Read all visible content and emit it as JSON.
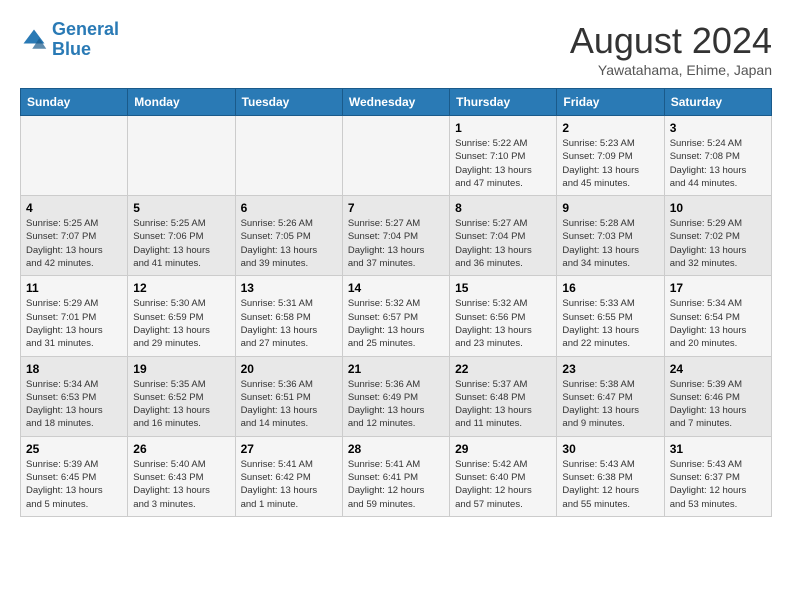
{
  "header": {
    "logo_line1": "General",
    "logo_line2": "Blue",
    "month_title": "August 2024",
    "subtitle": "Yawatahama, Ehime, Japan"
  },
  "weekdays": [
    "Sunday",
    "Monday",
    "Tuesday",
    "Wednesday",
    "Thursday",
    "Friday",
    "Saturday"
  ],
  "weeks": [
    [
      {
        "day": "",
        "info": ""
      },
      {
        "day": "",
        "info": ""
      },
      {
        "day": "",
        "info": ""
      },
      {
        "day": "",
        "info": ""
      },
      {
        "day": "1",
        "info": "Sunrise: 5:22 AM\nSunset: 7:10 PM\nDaylight: 13 hours\nand 47 minutes."
      },
      {
        "day": "2",
        "info": "Sunrise: 5:23 AM\nSunset: 7:09 PM\nDaylight: 13 hours\nand 45 minutes."
      },
      {
        "day": "3",
        "info": "Sunrise: 5:24 AM\nSunset: 7:08 PM\nDaylight: 13 hours\nand 44 minutes."
      }
    ],
    [
      {
        "day": "4",
        "info": "Sunrise: 5:25 AM\nSunset: 7:07 PM\nDaylight: 13 hours\nand 42 minutes."
      },
      {
        "day": "5",
        "info": "Sunrise: 5:25 AM\nSunset: 7:06 PM\nDaylight: 13 hours\nand 41 minutes."
      },
      {
        "day": "6",
        "info": "Sunrise: 5:26 AM\nSunset: 7:05 PM\nDaylight: 13 hours\nand 39 minutes."
      },
      {
        "day": "7",
        "info": "Sunrise: 5:27 AM\nSunset: 7:04 PM\nDaylight: 13 hours\nand 37 minutes."
      },
      {
        "day": "8",
        "info": "Sunrise: 5:27 AM\nSunset: 7:04 PM\nDaylight: 13 hours\nand 36 minutes."
      },
      {
        "day": "9",
        "info": "Sunrise: 5:28 AM\nSunset: 7:03 PM\nDaylight: 13 hours\nand 34 minutes."
      },
      {
        "day": "10",
        "info": "Sunrise: 5:29 AM\nSunset: 7:02 PM\nDaylight: 13 hours\nand 32 minutes."
      }
    ],
    [
      {
        "day": "11",
        "info": "Sunrise: 5:29 AM\nSunset: 7:01 PM\nDaylight: 13 hours\nand 31 minutes."
      },
      {
        "day": "12",
        "info": "Sunrise: 5:30 AM\nSunset: 6:59 PM\nDaylight: 13 hours\nand 29 minutes."
      },
      {
        "day": "13",
        "info": "Sunrise: 5:31 AM\nSunset: 6:58 PM\nDaylight: 13 hours\nand 27 minutes."
      },
      {
        "day": "14",
        "info": "Sunrise: 5:32 AM\nSunset: 6:57 PM\nDaylight: 13 hours\nand 25 minutes."
      },
      {
        "day": "15",
        "info": "Sunrise: 5:32 AM\nSunset: 6:56 PM\nDaylight: 13 hours\nand 23 minutes."
      },
      {
        "day": "16",
        "info": "Sunrise: 5:33 AM\nSunset: 6:55 PM\nDaylight: 13 hours\nand 22 minutes."
      },
      {
        "day": "17",
        "info": "Sunrise: 5:34 AM\nSunset: 6:54 PM\nDaylight: 13 hours\nand 20 minutes."
      }
    ],
    [
      {
        "day": "18",
        "info": "Sunrise: 5:34 AM\nSunset: 6:53 PM\nDaylight: 13 hours\nand 18 minutes."
      },
      {
        "day": "19",
        "info": "Sunrise: 5:35 AM\nSunset: 6:52 PM\nDaylight: 13 hours\nand 16 minutes."
      },
      {
        "day": "20",
        "info": "Sunrise: 5:36 AM\nSunset: 6:51 PM\nDaylight: 13 hours\nand 14 minutes."
      },
      {
        "day": "21",
        "info": "Sunrise: 5:36 AM\nSunset: 6:49 PM\nDaylight: 13 hours\nand 12 minutes."
      },
      {
        "day": "22",
        "info": "Sunrise: 5:37 AM\nSunset: 6:48 PM\nDaylight: 13 hours\nand 11 minutes."
      },
      {
        "day": "23",
        "info": "Sunrise: 5:38 AM\nSunset: 6:47 PM\nDaylight: 13 hours\nand 9 minutes."
      },
      {
        "day": "24",
        "info": "Sunrise: 5:39 AM\nSunset: 6:46 PM\nDaylight: 13 hours\nand 7 minutes."
      }
    ],
    [
      {
        "day": "25",
        "info": "Sunrise: 5:39 AM\nSunset: 6:45 PM\nDaylight: 13 hours\nand 5 minutes."
      },
      {
        "day": "26",
        "info": "Sunrise: 5:40 AM\nSunset: 6:43 PM\nDaylight: 13 hours\nand 3 minutes."
      },
      {
        "day": "27",
        "info": "Sunrise: 5:41 AM\nSunset: 6:42 PM\nDaylight: 13 hours\nand 1 minute."
      },
      {
        "day": "28",
        "info": "Sunrise: 5:41 AM\nSunset: 6:41 PM\nDaylight: 12 hours\nand 59 minutes."
      },
      {
        "day": "29",
        "info": "Sunrise: 5:42 AM\nSunset: 6:40 PM\nDaylight: 12 hours\nand 57 minutes."
      },
      {
        "day": "30",
        "info": "Sunrise: 5:43 AM\nSunset: 6:38 PM\nDaylight: 12 hours\nand 55 minutes."
      },
      {
        "day": "31",
        "info": "Sunrise: 5:43 AM\nSunset: 6:37 PM\nDaylight: 12 hours\nand 53 minutes."
      }
    ]
  ]
}
